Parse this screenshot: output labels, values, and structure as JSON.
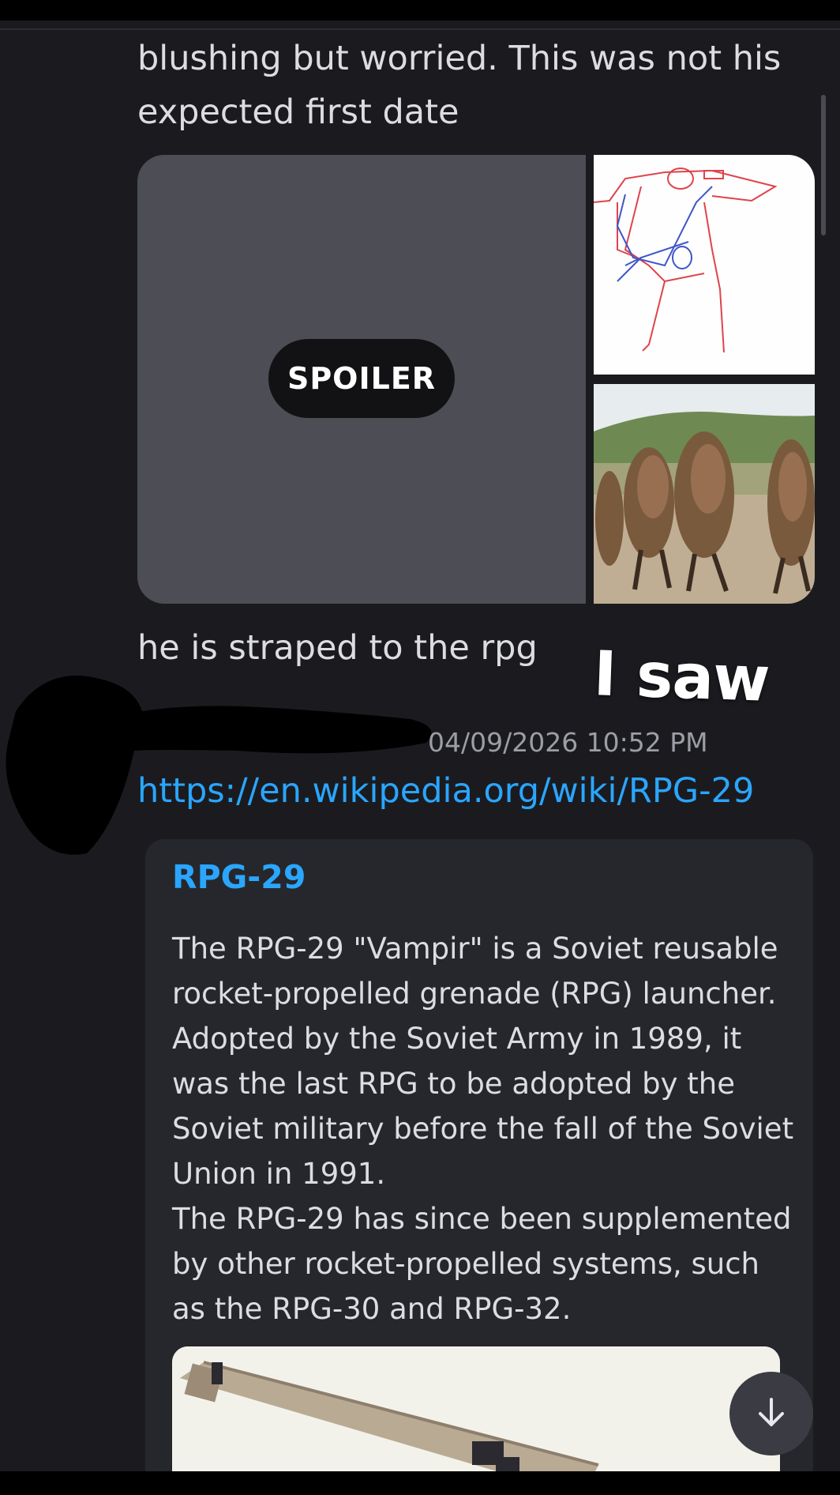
{
  "messages": {
    "first_text_line1": "blushing but worried. This was not his",
    "first_text_line2": "expected first date",
    "spoiler_label": "SPOILER",
    "second_text": "he is straped to the rpg",
    "overlay_caption": "I saw",
    "timestamp": "04/09/2026 10:52 PM",
    "link": "https://en.wikipedia.org/wiki/RPG-29"
  },
  "embed": {
    "title": "RPG-29",
    "paragraph1": "The RPG-29 \"Vampir\" is a Soviet reusable rocket-propelled grenade (RPG) launcher. Adopted by the Soviet Army in 1989, it was the last RPG to be adopted by the Soviet military before the fall of the Soviet Union in 1991.",
    "paragraph2": "The RPG-29 has since been supplemented by other rocket-propelled systems, such as the RPG-30 and RPG-32."
  },
  "icons": {
    "scroll_down": "arrow-down-icon"
  },
  "colors": {
    "background": "#1b1b1f",
    "link": "#2aa6ff",
    "embed_bg": "#26272d",
    "spoiler_bg": "#4c4d55"
  }
}
